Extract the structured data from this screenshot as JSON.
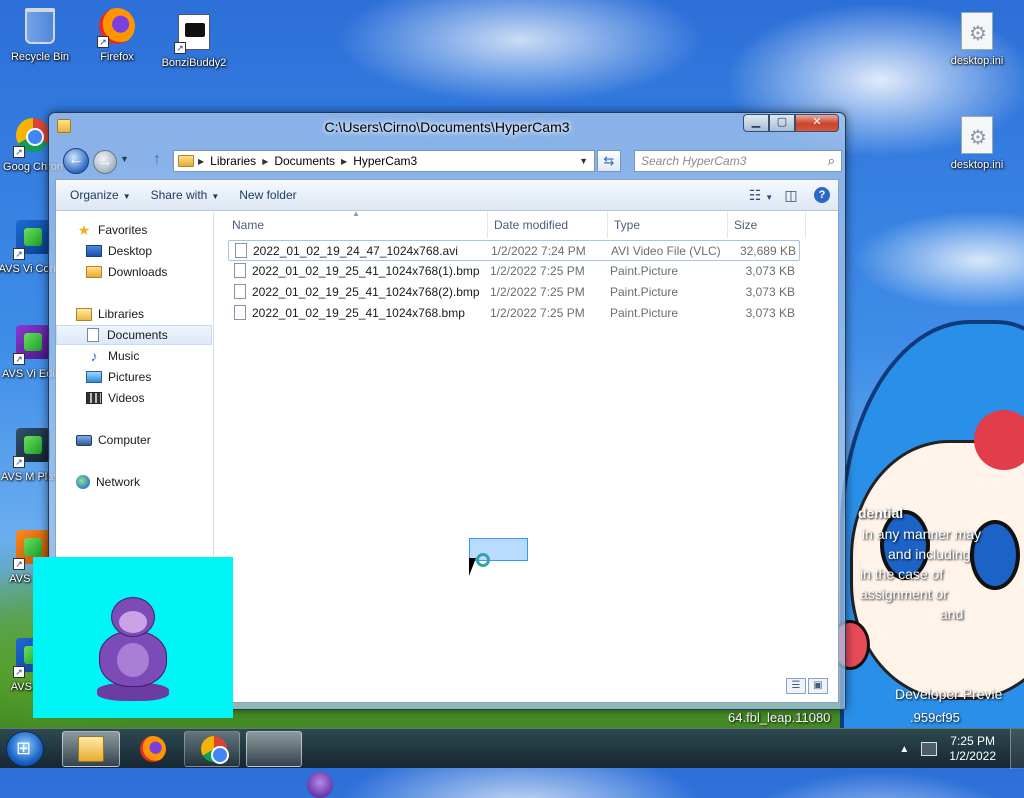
{
  "desktop": {
    "icons": [
      {
        "label": "Recycle Bin"
      },
      {
        "label": "Firefox"
      },
      {
        "label": "BonziBuddy2"
      },
      {
        "label": "Goog Chron"
      },
      {
        "label": "AVS Vi Conve"
      },
      {
        "label": "AVS Vi Edito"
      },
      {
        "label": "AVS M Playe"
      },
      {
        "label": "AVS ReM"
      },
      {
        "label": "AVS Con"
      },
      {
        "label": "desktop.ini"
      },
      {
        "label": "desktop.ini"
      }
    ],
    "watermark": {
      "line1": "dential",
      "line2": "in any manner may",
      "line3": "and including",
      "line4": "in the case of",
      "line5": "assignment or",
      "line6": "and",
      "line7": "Developer Previe",
      "line8": "64.fbl_leap.11080",
      "line9": ".959cf95"
    }
  },
  "window": {
    "title": "C:\\Users\\Cirno\\Documents\\HyperCam3",
    "address": [
      "Libraries",
      "Documents",
      "HyperCam3"
    ],
    "search_placeholder": "Search HyperCam3",
    "toolbar": {
      "organize": "Organize",
      "share_with": "Share with",
      "new_folder": "New folder"
    },
    "nav": {
      "favorites": "Favorites",
      "desktop": "Desktop",
      "downloads": "Downloads",
      "libraries": "Libraries",
      "documents": "Documents",
      "music": "Music",
      "pictures": "Pictures",
      "videos": "Videos",
      "computer": "Computer",
      "network": "Network"
    },
    "columns": {
      "name": "Name",
      "date": "Date modified",
      "type": "Type",
      "size": "Size"
    },
    "files": [
      {
        "name": "2022_01_02_19_24_47_1024x768.avi",
        "date": "1/2/2022 7:24 PM",
        "type": "AVI Video File (VLC)",
        "size": "32,689 KB"
      },
      {
        "name": "2022_01_02_19_25_41_1024x768(1).bmp",
        "date": "1/2/2022 7:25 PM",
        "type": "Paint.Picture",
        "size": "3,073 KB"
      },
      {
        "name": "2022_01_02_19_25_41_1024x768(2).bmp",
        "date": "1/2/2022 7:25 PM",
        "type": "Paint.Picture",
        "size": "3,073 KB"
      },
      {
        "name": "2022_01_02_19_25_41_1024x768.bmp",
        "date": "1/2/2022 7:25 PM",
        "type": "Paint.Picture",
        "size": "3,073 KB"
      }
    ]
  },
  "taskbar": {
    "time": "7:25 PM",
    "date": "1/2/2022"
  },
  "icons": {
    "back": "arrow-left-icon",
    "forward": "arrow-right-icon",
    "up": "arrow-up-icon",
    "refresh": "refresh-icon",
    "search": "magnifier-icon"
  },
  "colors": {
    "selection": "#3399ff",
    "bonzi_background": "#00f6f6",
    "close_button": "#c9452d"
  }
}
